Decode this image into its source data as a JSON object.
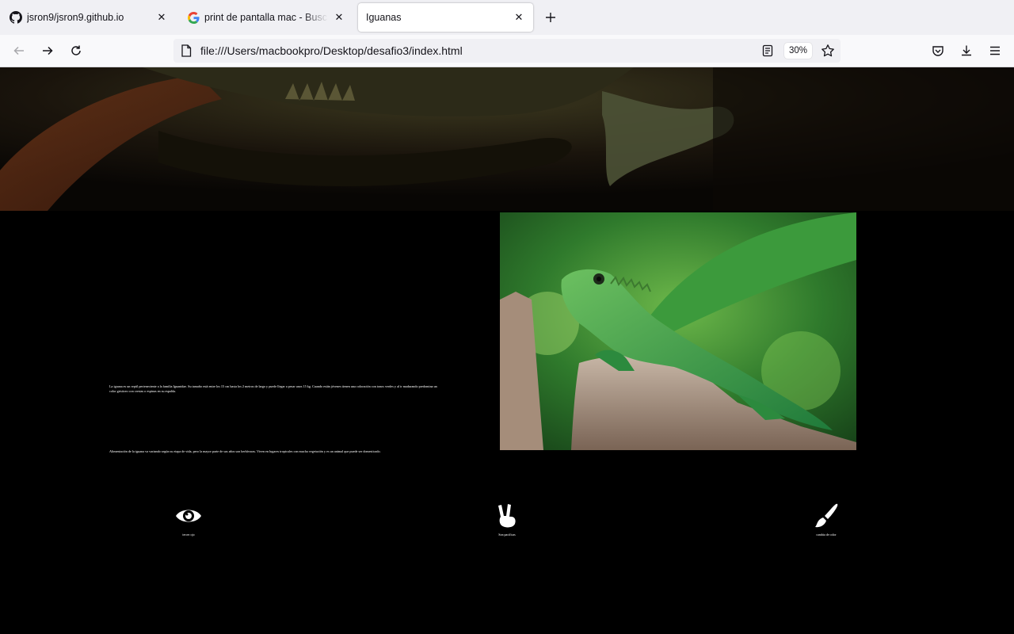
{
  "browser": {
    "tabs": [
      {
        "title": "jsron9/jsron9.github.io",
        "favicon": "github-icon",
        "active": false
      },
      {
        "title": "print de pantalla mac - Buscar c",
        "favicon": "google-icon",
        "active": false
      },
      {
        "title": "Iguanas",
        "favicon": "",
        "active": true
      }
    ],
    "url": "file:///Users/macbookpro/Desktop/desafio3/index.html",
    "zoom": "30%"
  },
  "content": {
    "paragraph1": "La iguana es un reptil perteneciente a la familia Iguanidae. Su tamaño está entre los 15 cm hasta los 2 metros de largo y puede llegar a pesar unos 15 kg. Cuando están jóvenes tienen una coloración con tonos verdes y al ir madurando predomina un color grisáceo con crestas o espinas en su espalda.",
    "paragraph2": "Alimentación de la iguana va variando según su etapa de vida, pero la mayor parte de sus años son herbívoras. Viven en lugares tropicales con mucha vegetación y es un animal que puede ser domesticado.",
    "features": [
      {
        "icon": "eye-icon",
        "label": "tercer ojo"
      },
      {
        "icon": "peace-hand-icon",
        "label": "Son pacificas"
      },
      {
        "icon": "paint-brush-icon",
        "label": "cambia de color"
      }
    ]
  },
  "colors": {
    "page_bg": "#000000",
    "tabstrip_bg": "#f0f0f4",
    "toolbar_bg": "#f9f9fb",
    "iguana_green": "#3f9a3a"
  }
}
